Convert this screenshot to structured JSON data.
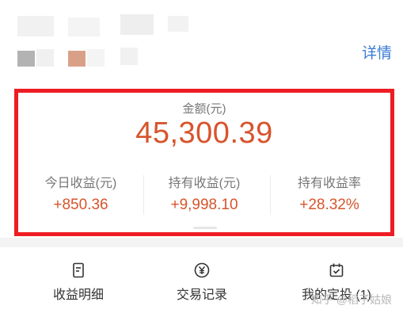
{
  "header": {
    "details_link": "详情"
  },
  "summary": {
    "amount_label": "金额(元)",
    "amount_value": "45,300.39",
    "stats": [
      {
        "label": "今日收益(元)",
        "value": "+850.36"
      },
      {
        "label": "持有收益(元)",
        "value": "+9,998.10"
      },
      {
        "label": "持有收益率",
        "value": "+28.32%"
      }
    ]
  },
  "tabs": [
    {
      "label": "收益明细",
      "icon": "document-icon"
    },
    {
      "label": "交易记录",
      "icon": "yen-circle-icon"
    },
    {
      "label": "我的定投 (1)",
      "icon": "calendar-check-icon"
    }
  ],
  "watermark": "知乎 @稻子姑娘",
  "colors": {
    "accent_red": "#d7542c",
    "highlight_border": "#ee1c23",
    "link_blue": "#3a7bd5"
  }
}
